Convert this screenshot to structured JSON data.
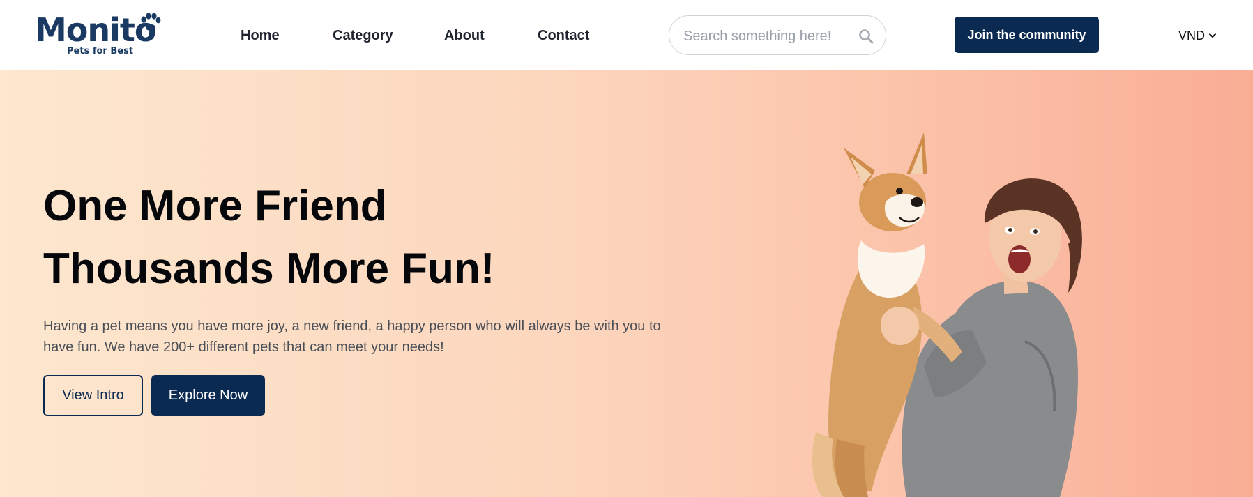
{
  "brand": {
    "name": "Monito",
    "tagline": "Pets for Best",
    "color": "#1a3a63",
    "logo_icon": "paw-icon"
  },
  "nav": {
    "items": [
      {
        "label": "Home"
      },
      {
        "label": "Category"
      },
      {
        "label": "About"
      },
      {
        "label": "Contact"
      }
    ]
  },
  "search": {
    "value": "",
    "placeholder": "Search something here!",
    "icon": "search-icon"
  },
  "header": {
    "join_label": "Join the community",
    "currency": "VND",
    "currency_icon": "chevron-down-icon"
  },
  "hero": {
    "title_line1": "One More Friend",
    "title_line2": "Thousands More Fun!",
    "description": "Having a pet means you have more joy, a new friend, a happy person who will always be with you to have fun. We have 200+ different pets that can meet your needs!",
    "view_intro_label": "View Intro",
    "explore_label": "Explore Now",
    "image": "woman-holding-corgi-photo"
  },
  "colors": {
    "primary": "#0b2a52",
    "hero_gradient_start": "#fde7cf",
    "hero_gradient_end": "#f9ad95"
  }
}
